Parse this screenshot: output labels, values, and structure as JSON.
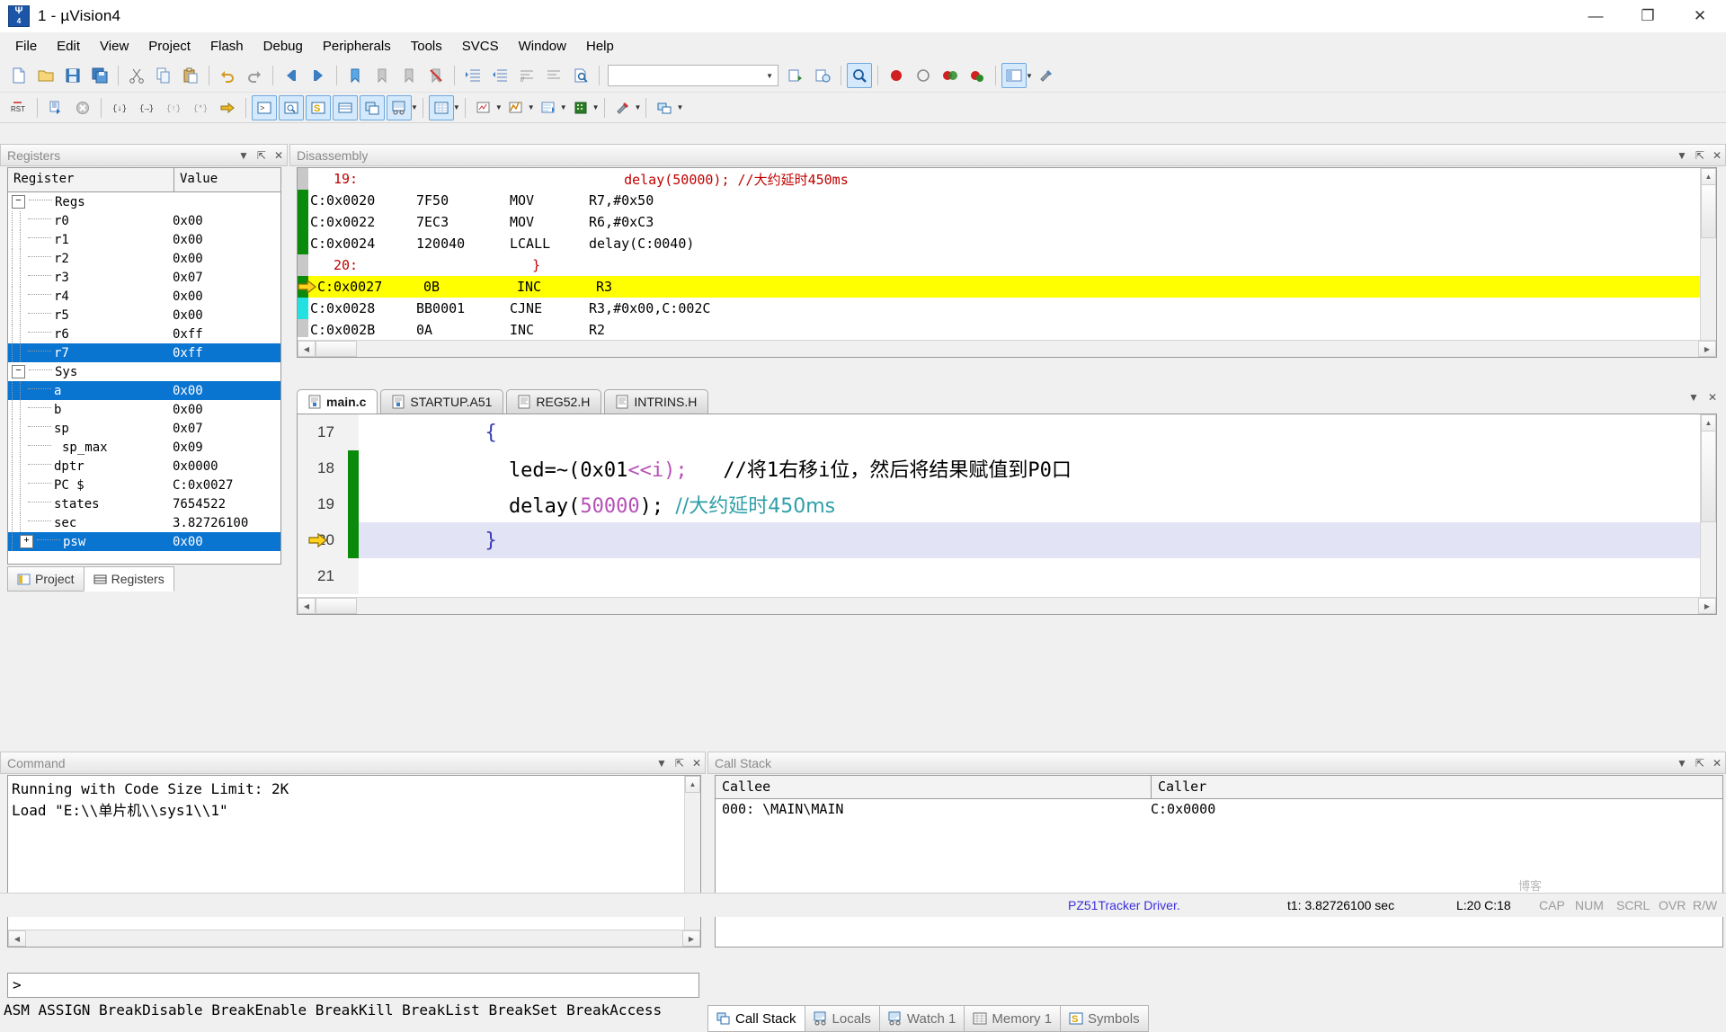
{
  "window": {
    "title": "1 - µVision4",
    "icon_label": "uvision-logo",
    "buttons": {
      "minimize": "—",
      "maximize": "❐",
      "close": "✕"
    }
  },
  "menubar": [
    {
      "label": "File",
      "accel": "F"
    },
    {
      "label": "Edit",
      "accel": "E"
    },
    {
      "label": "View",
      "accel": "V"
    },
    {
      "label": "Project",
      "accel": "P"
    },
    {
      "label": "Flash",
      "accel": "l"
    },
    {
      "label": "Debug",
      "accel": "D"
    },
    {
      "label": "Peripherals",
      "accel": "P"
    },
    {
      "label": "Tools",
      "accel": "T"
    },
    {
      "label": "SVCS",
      "accel": "S"
    },
    {
      "label": "Window",
      "accel": "W"
    },
    {
      "label": "Help",
      "accel": "H"
    }
  ],
  "toolbar_main": {
    "icons": [
      "new-file-icon",
      "open-file-icon",
      "save-icon",
      "save-all-icon",
      "cut-icon",
      "copy-icon",
      "paste-icon",
      "undo-icon",
      "redo-icon",
      "navigate-back-icon",
      "navigate-forward-icon",
      "bookmark-toggle-icon",
      "bookmark-prev-icon",
      "bookmark-next-icon",
      "bookmark-clear-icon",
      "indent-icon",
      "outdent-icon",
      "comment-icon",
      "uncomment-icon",
      "find-in-files-icon"
    ],
    "target_combo_value": "",
    "right_icons": [
      "build-target-icon",
      "target-options-icon",
      "find-icon",
      "insert-breakpoint-icon",
      "enable-breakpoint-icon",
      "disable-all-breakpoints-icon",
      "kill-all-breakpoints-icon",
      "project-window-icon",
      "configure-icon"
    ]
  },
  "toolbar_debug": {
    "icons": [
      "reset-cpu-icon",
      "run-icon",
      "stop-icon",
      "step-into-icon",
      "step-over-icon",
      "step-out-icon",
      "run-to-cursor-icon",
      "show-next-statement-icon",
      "command-window-icon",
      "disassembly-window-icon",
      "symbols-window-icon",
      "registers-window-icon",
      "call-stack-window-icon",
      "watch-window-icon",
      "memory-window-icon",
      "serial-window-icon",
      "analysis-window-icon",
      "trace-icon",
      "system-viewer-icon",
      "toolbox-icon",
      "debug-restore-views-icon"
    ]
  },
  "registers_panel": {
    "title": "Registers",
    "columns": [
      "Register",
      "Value"
    ],
    "tools": [
      "chevron-down-icon",
      "pin-icon",
      "close-icon"
    ],
    "groups": [
      {
        "name": "Regs",
        "expanded": true,
        "rows": [
          {
            "name": "r0",
            "value": "0x00",
            "selected": false
          },
          {
            "name": "r1",
            "value": "0x00",
            "selected": false
          },
          {
            "name": "r2",
            "value": "0x00",
            "selected": false
          },
          {
            "name": "r3",
            "value": "0x07",
            "selected": false
          },
          {
            "name": "r4",
            "value": "0x00",
            "selected": false
          },
          {
            "name": "r5",
            "value": "0x00",
            "selected": false
          },
          {
            "name": "r6",
            "value": "0xff",
            "selected": false
          },
          {
            "name": "r7",
            "value": "0xff",
            "selected": true
          }
        ]
      },
      {
        "name": "Sys",
        "expanded": true,
        "rows": [
          {
            "name": "a",
            "value": "0x00",
            "selected": true
          },
          {
            "name": "b",
            "value": "0x00",
            "selected": false
          },
          {
            "name": "sp",
            "value": "0x07",
            "selected": false
          },
          {
            "name": "sp_max",
            "value": "0x09",
            "selected": false,
            "indent": true
          },
          {
            "name": "dptr",
            "value": "0x0000",
            "selected": false
          },
          {
            "name": "PC  $",
            "value": "C:0x0027",
            "selected": false
          },
          {
            "name": "states",
            "value": "7654522",
            "selected": false
          },
          {
            "name": "sec",
            "value": "3.82726100",
            "selected": false
          },
          {
            "name": "psw",
            "value": "0x00",
            "selected": true,
            "expandable": true
          }
        ]
      }
    ],
    "dock_tabs": [
      {
        "label": "Project",
        "icon": "project-icon",
        "active": false
      },
      {
        "label": "Registers",
        "icon": "registers-icon",
        "active": true
      }
    ]
  },
  "disassembly_panel": {
    "title": "Disassembly",
    "tools": [
      "chevron-down-icon",
      "pin-icon",
      "close-icon"
    ],
    "lines": [
      {
        "type": "source",
        "gutter": "gray",
        "number": "19:",
        "text": "delay(50000); //大约延时450ms",
        "indent": 320
      },
      {
        "type": "asm",
        "gutter": "green",
        "address": "C:0x0020",
        "hex": "7F50",
        "mnemonic": "MOV",
        "operands": "R7,#0x50"
      },
      {
        "type": "asm",
        "gutter": "green",
        "address": "C:0x0022",
        "hex": "7EC3",
        "mnemonic": "MOV",
        "operands": "R6,#0xC3"
      },
      {
        "type": "asm",
        "gutter": "green",
        "address": "C:0x0024",
        "hex": "120040",
        "mnemonic": "LCALL",
        "operands": "delay(C:0040)"
      },
      {
        "type": "source",
        "gutter": "gray",
        "number": "20:",
        "text": "}",
        "indent": 218
      },
      {
        "type": "asm",
        "gutter": "green",
        "address": "C:0x0027",
        "hex": "0B",
        "mnemonic": "INC",
        "operands": "R3",
        "current": true
      },
      {
        "type": "asm",
        "gutter": "cyan",
        "address": "C:0x0028",
        "hex": "BB0001",
        "mnemonic": "CJNE",
        "operands": "R3,#0x00,C:002C"
      },
      {
        "type": "asm",
        "gutter": "gray",
        "address": "C:0x002B",
        "hex": "0A",
        "mnemonic": "INC",
        "operands": "R2"
      }
    ]
  },
  "editor": {
    "tabs": [
      {
        "label": "main.c",
        "icon": "c-file-icon",
        "active": true
      },
      {
        "label": "STARTUP.A51",
        "icon": "asm-file-icon",
        "active": false
      },
      {
        "label": "REG52.H",
        "icon": "h-file-icon",
        "active": false
      },
      {
        "label": "INTRINS.H",
        "icon": "h-file-icon",
        "active": false
      }
    ],
    "tools": [
      "chevron-down-icon",
      "close-icon"
    ],
    "lines": [
      {
        "num": "17",
        "gutter": "none",
        "current": false,
        "segments": [
          {
            "t": "indent",
            "v": "          "
          },
          {
            "t": "brace",
            "v": "{"
          }
        ]
      },
      {
        "num": "18",
        "gutter": "green",
        "current": false,
        "segments": [
          {
            "t": "plain",
            "v": "            led=~("
          },
          {
            "t": "num",
            "v": "0x01"
          },
          {
            "t": "plain",
            "v": "<<i);   "
          },
          {
            "t": "cmt",
            "v": "//将1右移i位，然后将结果赋值到P0口"
          }
        ]
      },
      {
        "num": "19",
        "gutter": "green",
        "current": false,
        "segments": [
          {
            "t": "plain",
            "v": "            delay("
          },
          {
            "t": "num",
            "v": "50000"
          },
          {
            "t": "plain",
            "v": "); "
          },
          {
            "t": "cmt",
            "v": "//大约延时450ms"
          }
        ]
      },
      {
        "num": "20",
        "gutter": "green",
        "current": true,
        "segments": [
          {
            "t": "indent",
            "v": "          "
          },
          {
            "t": "brace",
            "v": "}"
          }
        ]
      },
      {
        "num": "21",
        "gutter": "none",
        "current": false,
        "segments": []
      }
    ]
  },
  "command_panel": {
    "title": "Command",
    "tools": [
      "chevron-down-icon",
      "pin-icon",
      "close-icon"
    ],
    "output": "Running with Code Size Limit: 2K\nLoad \"E:\\\\单片机\\\\sys1\\\\1\"",
    "prompt": ">",
    "input_value": "",
    "command_buttons": "ASM ASSIGN BreakDisable BreakEnable BreakKill BreakList BreakSet BreakAccess"
  },
  "callstack_panel": {
    "title": "Call Stack",
    "tools": [
      "chevron-down-icon",
      "pin-icon",
      "close-icon"
    ],
    "columns": [
      "Callee",
      "Caller"
    ],
    "rows": [
      {
        "callee": "000: \\MAIN\\MAIN",
        "caller": "C:0x0000"
      }
    ],
    "tabs": [
      {
        "label": "Call Stack",
        "icon": "call-stack-icon",
        "active": true
      },
      {
        "label": "Locals",
        "icon": "locals-icon",
        "active": false
      },
      {
        "label": "Watch 1",
        "icon": "watch-icon",
        "active": false
      },
      {
        "label": "Memory 1",
        "icon": "memory-icon",
        "active": false
      },
      {
        "label": "Symbols",
        "icon": "symbols-icon",
        "active": false
      }
    ]
  },
  "status_bar": {
    "driver": "PZ51Tracker Driver.",
    "time": "t1: 3.82726100 sec",
    "position": "L:20 C:18",
    "flags": [
      "CAP",
      "NUM",
      "SCRL",
      "OVR",
      "R/W"
    ],
    "watermark": "博客"
  },
  "colors": {
    "accent_blue": "#0a74d1",
    "current_line_yellow": "#ffff00",
    "breakpoint_green": "#0a8a0a",
    "cyan_marker": "#24e1e1",
    "source_red": "#c00000",
    "comment_teal": "#2f9fa8",
    "number_magenta": "#b650b6",
    "brace_blue": "#3b3bb3",
    "status_driver": "#3b2fdd"
  }
}
